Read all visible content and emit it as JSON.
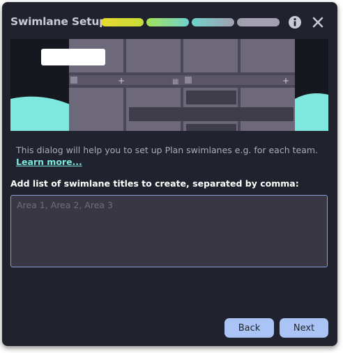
{
  "dialog": {
    "title": "Swimlane Setup",
    "info_icon": "info-circle-icon",
    "close_icon": "close-icon",
    "progress_colors": [
      "#e7d92f",
      "#a4e25a",
      "#6fd2cd",
      "#a3a1af",
      "#a3a1af"
    ]
  },
  "body": {
    "description": "This dialog will help you to set up Plan swimlanes e.g. for each team.",
    "learn_more": "Learn more...",
    "input_label": "Add list of swimlane titles to create, separated by comma:",
    "input_placeholder": "Area 1, Area 2, Area 3",
    "input_value": ""
  },
  "buttons": {
    "back": "Back",
    "next": "Next"
  }
}
